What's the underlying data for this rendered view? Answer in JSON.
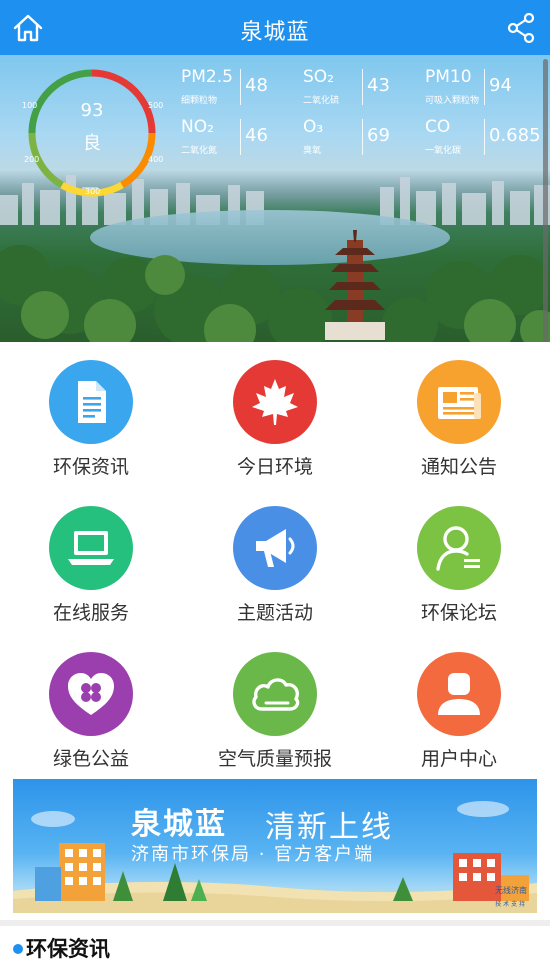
{
  "header": {
    "title": "泉城蓝"
  },
  "aqi": {
    "value": "93",
    "level": "良",
    "ticks": [
      "100",
      "500",
      "200",
      "400",
      "300"
    ],
    "gauge_colors": [
      "#e53935",
      "#fb8c00",
      "#fdd835",
      "#7cb342",
      "#43a047"
    ]
  },
  "pollutants": [
    {
      "name": "PM2.5",
      "sub": "细颗粒物",
      "value": "48"
    },
    {
      "name": "SO₂",
      "sub": "二氧化硫",
      "value": "43"
    },
    {
      "name": "PM10",
      "sub": "可吸入颗粒物",
      "value": "94"
    },
    {
      "name": "NO₂",
      "sub": "二氧化氮",
      "value": "46"
    },
    {
      "name": "O₃",
      "sub": "臭氧",
      "value": "69"
    },
    {
      "name": "CO",
      "sub": "一氧化碳",
      "value": "0.685"
    }
  ],
  "menu": [
    {
      "label": "环保资讯",
      "icon": "document-icon",
      "color": "#3aa6ee"
    },
    {
      "label": "今日环境",
      "icon": "maple-leaf-icon",
      "color": "#e53935"
    },
    {
      "label": "通知公告",
      "icon": "newspaper-icon",
      "color": "#f7a12e"
    },
    {
      "label": "在线服务",
      "icon": "laptop-icon",
      "color": "#26c07e"
    },
    {
      "label": "主题活动",
      "icon": "megaphone-icon",
      "color": "#4a8fe6"
    },
    {
      "label": "环保论坛",
      "icon": "forum-user-icon",
      "color": "#7cc243"
    },
    {
      "label": "绿色公益",
      "icon": "clover-heart-icon",
      "color": "#9c3fae"
    },
    {
      "label": "空气质量预报",
      "icon": "cloud-icon",
      "color": "#6ab84a"
    },
    {
      "label": "用户中心",
      "icon": "user-icon",
      "color": "#f26a3d"
    }
  ],
  "banner": {
    "title_bold": "泉城蓝",
    "title_rest": "清新上线",
    "subtitle": "济南市环保局 · 官方客户端",
    "support_line1": "无线济南",
    "support_line2": "技 术 支 持"
  },
  "section": {
    "title": "环保资讯"
  }
}
